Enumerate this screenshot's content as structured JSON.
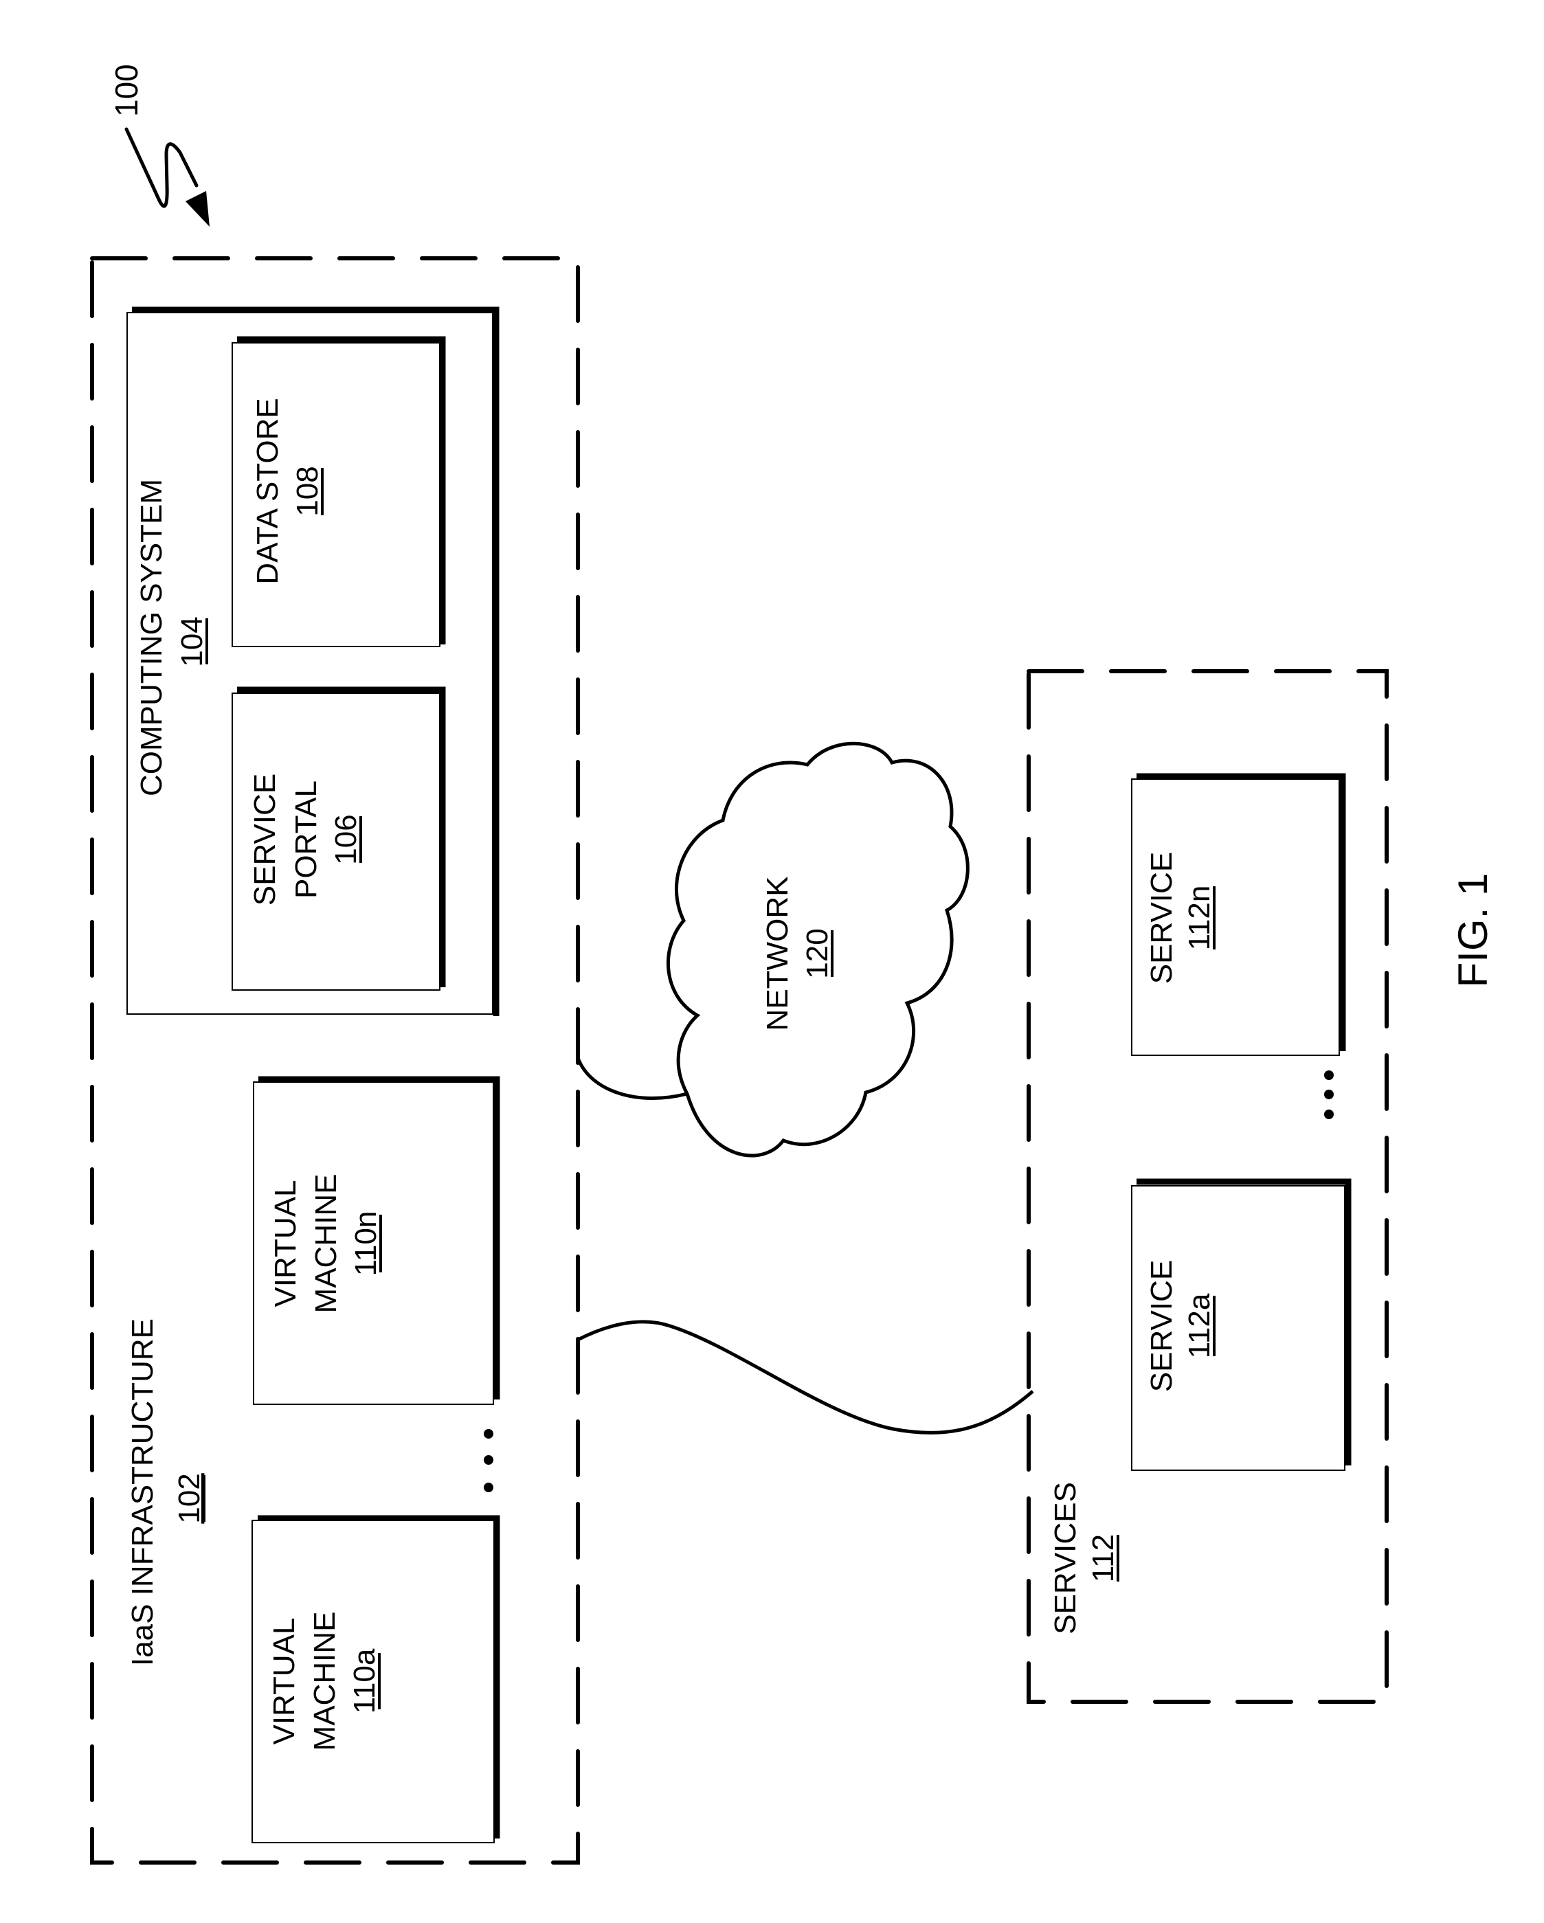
{
  "figure": {
    "reference": "100",
    "caption": "FIG. 1"
  },
  "iaas": {
    "title": "IaaS INFRASTRUCTURE",
    "ref": "102",
    "computing_system": {
      "title": "COMPUTING SYSTEM",
      "ref": "104",
      "service_portal": {
        "line1": "SERVICE",
        "line2": "PORTAL",
        "ref": "106"
      },
      "data_store": {
        "line1": "DATA STORE",
        "ref": "108"
      }
    },
    "virtual_machines": [
      {
        "line1": "VIRTUAL",
        "line2": "MACHINE",
        "ref": "110a"
      },
      {
        "line1": "VIRTUAL",
        "line2": "MACHINE",
        "ref": "110n"
      }
    ]
  },
  "network": {
    "title": "NETWORK",
    "ref": "120"
  },
  "services": {
    "title": "SERVICES",
    "ref": "112",
    "items": [
      {
        "line1": "SERVICE",
        "ref": "112a"
      },
      {
        "line1": "SERVICE",
        "ref": "112n"
      }
    ]
  },
  "colors": {
    "ink": "#000000",
    "paper": "#ffffff"
  }
}
